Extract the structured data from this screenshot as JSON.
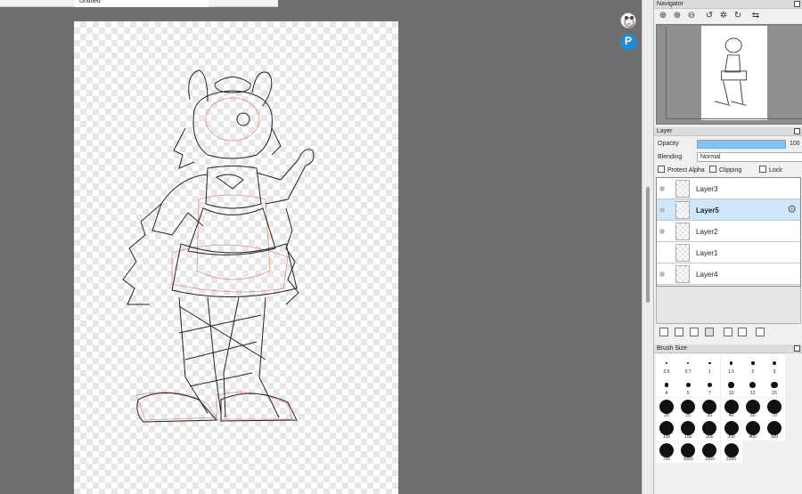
{
  "document": {
    "tab_title": "Untitled"
  },
  "floating": {
    "pixiv_letter": "P"
  },
  "navigator": {
    "title": "Navigator",
    "tools": [
      {
        "icon": "zoom-in-icon",
        "glyph": "⊕"
      },
      {
        "icon": "zoom-in-alt-icon",
        "glyph": "⊕"
      },
      {
        "icon": "zoom-out-icon",
        "glyph": "⊖"
      },
      {
        "icon": "rotate-left-icon",
        "glyph": "↺"
      },
      {
        "icon": "reset-rotation-icon",
        "glyph": "✲"
      },
      {
        "icon": "rotate-right-icon",
        "glyph": "↻"
      },
      {
        "icon": "flip-icon",
        "glyph": "⇆"
      }
    ]
  },
  "layer_panel": {
    "title": "Layer",
    "opacity_label": "Opacity",
    "opacity_value": "100",
    "opacity_fraction": 1.0,
    "blending_label": "Blending",
    "blending_value": "Normal",
    "protect_alpha_label": "Protect Alpha",
    "clipping_label": "Clipping",
    "lock_label": "Lock",
    "layers": [
      {
        "name": "Layer3",
        "visible": true,
        "selected": false
      },
      {
        "name": "Layer5",
        "visible": true,
        "selected": true
      },
      {
        "name": "Layer2",
        "visible": true,
        "selected": false
      },
      {
        "name": "Layer1",
        "visible": false,
        "selected": false
      },
      {
        "name": "Layer4",
        "visible": true,
        "selected": false
      }
    ],
    "tools": [
      {
        "icon": "new-layer-icon"
      },
      {
        "icon": "new-layer-8bpp-icon"
      },
      {
        "icon": "new-layer-1bpp-icon"
      },
      {
        "icon": "new-folder-icon"
      },
      {
        "icon": "duplicate-layer-icon"
      },
      {
        "icon": "merge-down-icon"
      },
      {
        "icon": "delete-layer-icon"
      }
    ]
  },
  "brush_panel": {
    "title": "Brush Size",
    "sizes": [
      "0.5",
      "0.7",
      "1",
      "1.5",
      "2",
      "3",
      "4",
      "5",
      "7",
      "10",
      "12",
      "15",
      "20",
      "25",
      "30",
      "40",
      "50",
      "70",
      "100",
      "150",
      "200",
      "300",
      "400",
      "500",
      "700",
      "1000",
      "1500",
      "2000"
    ]
  },
  "colors": {
    "accent": "#86c2ee",
    "selection": "#cfe7fb",
    "pixiv": "#1a8fe0",
    "sketch_red": "#e07070"
  }
}
